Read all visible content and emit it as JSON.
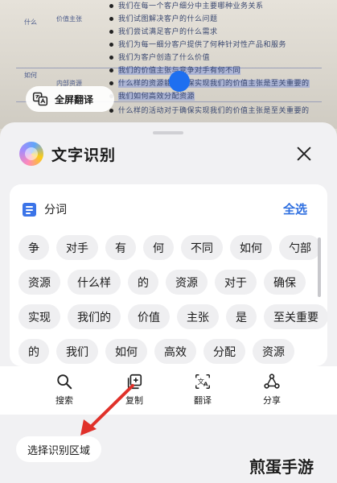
{
  "background_page": {
    "lines": [
      "我们在每一个客户细分中主要哪种业务关系",
      "我们试图解决客户的什么问题",
      "我们尝试满足客户的什么需求",
      "我们为每一细分客户提供了何种针对性产品和服务",
      "我们为客户创造了什么价值",
      "我们的价值主张与竞争对手有何不同",
      "什么样的资源能够确保实现我们的价值主张是至关重要的",
      "我们如何高效分配资源",
      "什么样的活动对于确保实现我们的价值主张是至关重要的"
    ],
    "side_labels": [
      "什么",
      "价值主张",
      "如何",
      "内部资源"
    ]
  },
  "fullscreen_translate": {
    "label": "全屏翻译",
    "icon": "translate-icon"
  },
  "sheet": {
    "title": "文字识别",
    "close_icon": "close-icon",
    "segment_label": "分词",
    "select_all_label": "全选",
    "chip_rows": [
      [
        "争",
        "对手",
        "有",
        "何",
        "不同",
        "如何",
        "勺部"
      ],
      [
        "资源",
        "什么样",
        "的",
        "资源",
        "对于",
        "确保"
      ],
      [
        "实现",
        "我们的",
        "价值",
        "主张",
        "是",
        "至关重要"
      ],
      [
        "的",
        "我们",
        "如何",
        "高效",
        "分配",
        "资源"
      ]
    ]
  },
  "toolbar": {
    "items": [
      {
        "label": "搜索",
        "icon": "search-icon"
      },
      {
        "label": "复制",
        "icon": "copy-icon"
      },
      {
        "label": "翻译",
        "icon": "translate-icon"
      },
      {
        "label": "分享",
        "icon": "share-icon"
      }
    ]
  },
  "select_area_label": "选择识别区域",
  "watermark": "煎蛋手游",
  "colors": {
    "accent": "#2f6fe0",
    "cursor": "#1e6ff0",
    "arrow": "#e0312a",
    "sheet_bg": "#f1f1f3"
  }
}
